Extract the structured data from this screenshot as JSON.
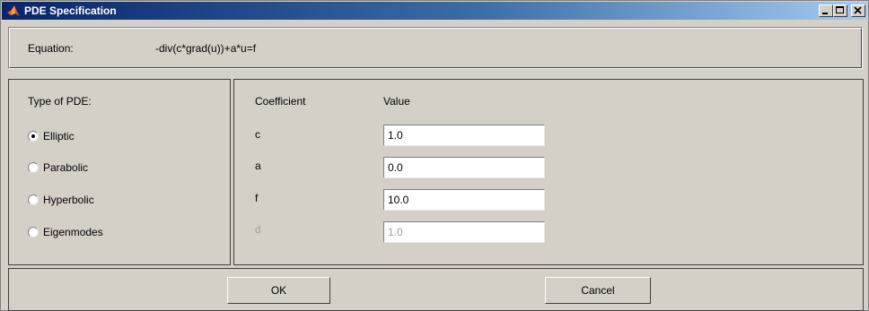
{
  "window": {
    "title": "PDE Specification",
    "controls": [
      "minimize-icon",
      "maximize-icon",
      "close-icon"
    ]
  },
  "equation": {
    "label": "Equation:",
    "value": "-div(c*grad(u))+a*u=f"
  },
  "pde_type": {
    "heading": "Type of PDE:",
    "options": [
      {
        "label": "Elliptic",
        "selected": true
      },
      {
        "label": "Parabolic",
        "selected": false
      },
      {
        "label": "Hyperbolic",
        "selected": false
      },
      {
        "label": "Eigenmodes",
        "selected": false
      }
    ]
  },
  "coefficients": {
    "header_coefficient": "Coefficient",
    "header_value": "Value",
    "rows": [
      {
        "name": "c",
        "value": "1.0",
        "enabled": true
      },
      {
        "name": "a",
        "value": "0.0",
        "enabled": true
      },
      {
        "name": "f",
        "value": "10.0",
        "enabled": true
      },
      {
        "name": "d",
        "value": "1.0",
        "enabled": false
      }
    ]
  },
  "buttons": {
    "ok": "OK",
    "cancel": "Cancel"
  }
}
